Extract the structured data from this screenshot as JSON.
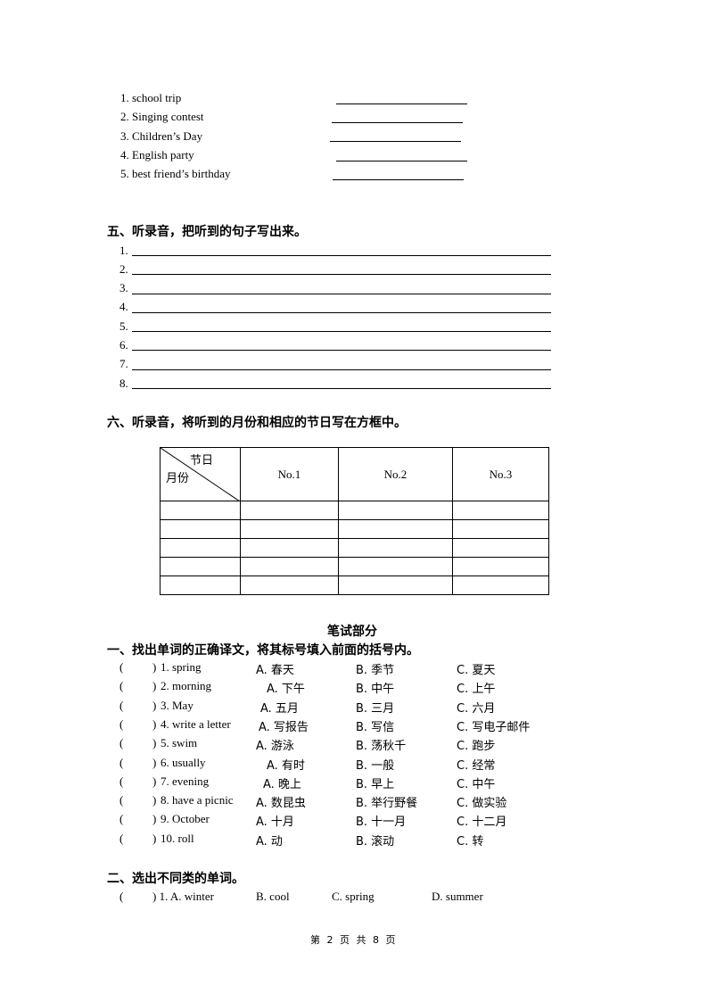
{
  "section4": {
    "items": [
      {
        "label": "1. school trip"
      },
      {
        "label": "2. Singing contest"
      },
      {
        "label": "3. Children’s Day"
      },
      {
        "label": "4. English party"
      },
      {
        "label": "5. best friend’s birthday"
      }
    ]
  },
  "section5": {
    "title": "五、听录音，把听到的句子写出来。",
    "lines": [
      "1.",
      "2.",
      "3.",
      "4.",
      "5.",
      "6.",
      "7.",
      "8."
    ]
  },
  "section6": {
    "title": "六、听录音，将听到的月份和相应的节日写在方框中。",
    "table": {
      "corner_top": "节日",
      "corner_bottom": "月份",
      "headers": [
        "No.1",
        "No.2",
        "No.3"
      ],
      "empty_rows": 5
    }
  },
  "written": {
    "title": "笔试部分",
    "part1": {
      "title": "一、找出单词的正确译文，将其标号填入前面的括号内。",
      "questions": [
        {
          "paren": "(",
          "close": ")",
          "word": "1. spring",
          "a": "A. 春天",
          "b": "B. 季节",
          "c": "C. 夏天"
        },
        {
          "paren": "(",
          "close": ")",
          "word": "2. morning",
          "a": "A. 下午",
          "b": "B. 中午",
          "c": "C. 上午"
        },
        {
          "paren": "(",
          "close": ")",
          "word": "3. May",
          "a": "A. 五月",
          "b": "B. 三月",
          "c": "C. 六月"
        },
        {
          "paren": "(",
          "close": ")",
          "word": "4. write a letter",
          "a": "A. 写报告",
          "b": "B. 写信",
          "c": "C. 写电子邮件"
        },
        {
          "paren": "(",
          "close": ")",
          "word": "5. swim",
          "a": "A. 游泳",
          "b": "B. 荡秋千",
          "c": "C. 跑步"
        },
        {
          "paren": "(",
          "close": ")",
          "word": "6. usually",
          "a": "A. 有时",
          "b": "B. 一般",
          "c": "C. 经常"
        },
        {
          "paren": "(",
          "close": ")",
          "word": "7. evening",
          "a": "A. 晚上",
          "b": "B. 早上",
          "c": "C. 中午"
        },
        {
          "paren": "(",
          "close": ")",
          "word": "8. have a picnic",
          "a": "A. 数昆虫",
          "b": "B. 举行野餐",
          "c": "C. 做实验"
        },
        {
          "paren": "(",
          "close": ")",
          "word": "9. October",
          "a": "A. 十月",
          "b": "B. 十一月",
          "c": "C. 十二月"
        },
        {
          "paren": "(",
          "close": ")",
          "word": "10. roll",
          "a": "A. 动",
          "b": "B. 滚动",
          "c": "C. 转"
        }
      ]
    },
    "part2": {
      "title": "二、选出不同类的单词。",
      "questions": [
        {
          "paren": "(",
          "close": ")",
          "num": "1.",
          "a": "A. winter",
          "b": "B. cool",
          "c": "C. spring",
          "d": "D. summer"
        }
      ]
    }
  },
  "footer": {
    "page_text": "第 2 页 共 8 页"
  }
}
